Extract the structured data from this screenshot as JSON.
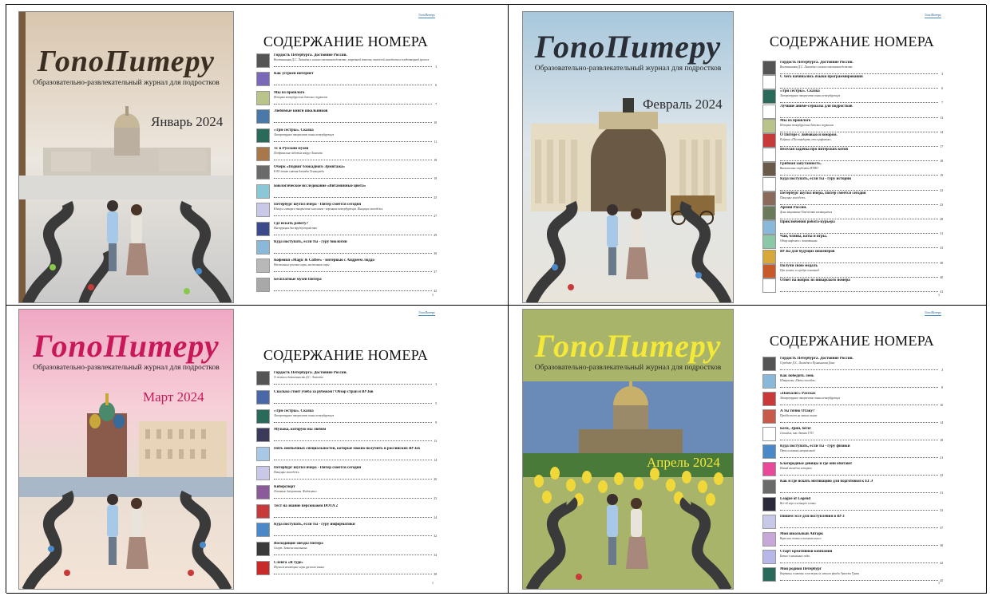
{
  "issues": [
    {
      "cover": {
        "title": "ГопоПитеру",
        "subtitle": "Образовательно-развлекательный журнал для подростков",
        "month": "Январь 2024",
        "colors": {
          "bg_top": "#d9c6ae",
          "bg_bottom": "#c9c9c9",
          "title": "#3a2e22",
          "month": "#2a2a2a",
          "frame": "#7a5a3c"
        }
      },
      "toc": {
        "brand": "ГопоПитеру",
        "heading": "СОДЕРЖАНИЕ НОМЕРА",
        "page_number": "1",
        "entries": [
          {
            "title": "Гордость Петербурга. Достояние России.",
            "sub": "Воспоминания Д.С. Лихачёва о самом счастливом детстве, запретной повести, тяжёлой молодости и плодотворной зрелости",
            "page": "3",
            "thumb": "#555555"
          },
          {
            "title": "Как устроен интернет",
            "sub": "",
            "page": "6",
            "thumb": "#7a68b8"
          },
          {
            "title": "Мы из прошлого",
            "sub": "История петербургских детских журналов",
            "page": "7",
            "thumb": "#b9c48a"
          },
          {
            "title": "Любимые книги школьников",
            "sub": "",
            "page": "10",
            "thumb": "#4a78a8"
          },
          {
            "title": "«Три сестры». Сказка",
            "sub": "Литературное творчество юных петербуржцев",
            "page": "11",
            "thumb": "#2a6a5a"
          },
          {
            "title": "Тс в Русский музей",
            "sub": "Поздравление задетых вокруг Лихачёва",
            "page": "18",
            "thumb": "#a8784a"
          },
          {
            "title": "Очерк «Подвиг блокадного Эрмитажа»",
            "sub": "К 80-летию снятия блокады Ленинграда",
            "page": "19",
            "thumb": "#6a6a6a"
          },
          {
            "title": "Биологическое исследование «Витаминные цвета»",
            "sub": "",
            "page": "25",
            "thumb": "#8ac8d8"
          },
          {
            "title": "Петербург шутил вчера - Питер смеётся сегодня",
            "sub": "Юмор и сатира в творчестве классиков - коренных петербуржцев. Пишущие молодёжь",
            "page": "27",
            "thumb": "#c8c8e8"
          },
          {
            "title": "Где искать работу?",
            "sub": "Инструкция для трудоустройства",
            "page": "29",
            "thumb": "#3a4a8a"
          },
          {
            "title": "Куда поступать, если ты - гуру биологии",
            "sub": "",
            "page": "30",
            "thumb": "#8ab8d8"
          },
          {
            "title": "Кофейня «Magic & Coffee» - интервью с Андреем Лоддо",
            "sub": "Настольные ролевые игры, настольные игры",
            "page": "37",
            "thumb": "#b8b8b8"
          },
          {
            "title": "Бесплатные музеи Питера",
            "sub": "",
            "page": "42",
            "thumb": "#a8a8a8"
          }
        ]
      }
    },
    {
      "cover": {
        "title": "ГопоПитеру",
        "subtitle": "Образовательно-развлекательный журнал для подростков",
        "month": "Февраль 2024",
        "colors": {
          "bg_top": "#a8c8dc",
          "bg_bottom": "#e8e4da",
          "title": "#2a2e36",
          "month": "#2a2a2a",
          "frame": "#999999"
        }
      },
      "toc": {
        "brand": "ГопоПитеру",
        "heading": "СОДЕРЖАНИЕ НОМЕРА",
        "page_number": "1",
        "entries": [
          {
            "title": "Гордость Петербурга. Достояние России.",
            "sub": "Воспоминания Д.С. Лихачёва о самом счастливом детстве",
            "page": "3",
            "thumb": "#555555"
          },
          {
            "title": "С чего начинались языки программирования",
            "sub": "",
            "page": "6",
            "thumb": "#ffffff"
          },
          {
            "title": "«Три сестры». Сказка",
            "sub": "Литературное творчество юных петербуржцев",
            "page": "7",
            "thumb": "#2a6a5a"
          },
          {
            "title": "Лучшие аниме-сериалы для подростков",
            "sub": "",
            "page": "13",
            "thumb": "#ffffff"
          },
          {
            "title": "Мы из прошлого",
            "sub": "История петербургских детских журналов",
            "page": "14",
            "thumb": "#b9c48a"
          },
          {
            "title": "О Питере с любовью и юмором.",
            "sub": "Рубрика «Шестнадцать лет в рифмовке»",
            "page": "17",
            "thumb": "#c83a3a"
          },
          {
            "title": "Весёлая задачка про питерских котов",
            "sub": "",
            "page": "18",
            "thumb": "#ffffff"
          },
          {
            "title": "Грибная запутанность.",
            "sub": "Внеклассные студенты ИТМО",
            "page": "19",
            "thumb": "#6a5a4a"
          },
          {
            "title": "Куда поступать, если ты - гуру истории",
            "sub": "",
            "page": "22",
            "thumb": "#ffffff"
          },
          {
            "title": "Петербург шутил вчера, Питер смеётся сегодня",
            "sub": "Пишущие молодёжь",
            "page": "23",
            "thumb": "#8a6a5a"
          },
          {
            "title": "Армия России.",
            "sub": "День защитника Отечества посвящается",
            "page": "28",
            "thumb": "#6a7a5a"
          },
          {
            "title": "Приключения робота-курьера",
            "sub": "",
            "page": "31",
            "thumb": "#8ab8d8"
          },
          {
            "title": "Чай, блины, коты и игры.",
            "sub": "Обзор кафешек с животными",
            "page": "33",
            "thumb": "#8ac8a8"
          },
          {
            "title": "ВУЗы для будущих инженеров",
            "sub": "",
            "page": "38",
            "thumb": "#d8a83a"
          },
          {
            "title": "Получи свою медаль",
            "sub": "Про золото и серебро олимпиад",
            "page": "40",
            "thumb": "#c85a2a"
          },
          {
            "title": "Ответ на вопрос из январского номера",
            "sub": "",
            "page": "41",
            "thumb": "#ffffff"
          }
        ]
      }
    },
    {
      "cover": {
        "title": "ГопоПитеру",
        "subtitle": "Образовательно-развлекательный журнал для подростков",
        "month": "Март 2024",
        "colors": {
          "bg_top": "#f0a8c4",
          "bg_bottom": "#f4e4d8",
          "title": "#c8185a",
          "month": "#c8185a",
          "frame": "#c87898"
        }
      },
      "toc": {
        "brand": "ГопоПитеру",
        "heading": "СОДЕРЖАНИЕ НОМЕРА",
        "page_number": "1",
        "entries": [
          {
            "title": "Гордость Петербурга. Достояние России.",
            "sub": "О жизни и деятельности Д.С. Лихачёва",
            "page": "3",
            "thumb": "#555555"
          },
          {
            "title": "Сколько стоит учёба за рубежом? Обзор стран и ВУЗов",
            "sub": "",
            "page": "5",
            "thumb": "#4a68a8"
          },
          {
            "title": "«Три сестры». Сказка",
            "sub": "Литературное творчество юных петербуржцев",
            "page": "9",
            "thumb": "#2a6a5a"
          },
          {
            "title": "Музыка, которую мы любим",
            "sub": "",
            "page": "13",
            "thumb": "#3a3a5a"
          },
          {
            "title": "Пять необычных специальностей, которые можно получить в российских ВУЗах",
            "sub": "",
            "page": "14",
            "thumb": "#a8c8e8"
          },
          {
            "title": "Петербург шутил вчера - Питер смеётся сегодня",
            "sub": "Пишущие молодёжь",
            "page": "20",
            "thumb": "#c8c8e8"
          },
          {
            "title": "Киберспорт",
            "sub": "Основные дисциплины. Фиджитал",
            "page": "23",
            "thumb": "#8a5a9a"
          },
          {
            "title": "Тест на знание персонажей DOTA 2",
            "sub": "",
            "page": "24",
            "thumb": "#c83a3a"
          },
          {
            "title": "Куда поступать, если ты - гуру информатики",
            "sub": "",
            "page": "32",
            "thumb": "#4a88c8"
          },
          {
            "title": "Восходящие звёзды Питера",
            "sub": "Спорт. Записки школьника.",
            "page": "34",
            "thumb": "#3a3a3a"
          },
          {
            "title": "Сленга «Я туде»",
            "sub": "Изучаем некоторые игры русского языка",
            "page": "38",
            "thumb": "#c82a2a"
          }
        ]
      }
    },
    {
      "cover": {
        "title": "ГопоПитеру",
        "subtitle": "Образовательно-развлекательный журнал для подростков",
        "month": "Апрель 2024",
        "colors": {
          "bg_top": "#a8b46a",
          "bg_bottom": "#9aaa5a",
          "title": "#f4e838",
          "month": "#f4e838",
          "frame": "#6a7a3a"
        }
      },
      "toc": {
        "brand": "ГопоПитеру",
        "heading": "СОДЕРЖАНИЕ НОМЕРА",
        "page_number": "1",
        "entries": [
          {
            "title": "Гордость Петербурга. Достояние России.",
            "sub": "О работе Д.С. Лихачёва в Пушкинском Доме",
            "page": "3",
            "thumb": "#555555"
          },
          {
            "title": "Как победить лень",
            "sub": "Шпаргалка «Пять способов»",
            "page": "8",
            "thumb": "#8ab8d8"
          },
          {
            "title": "«Поехали!» Рассказ",
            "sub": "Литературное творчество юных петербуржцев",
            "page": "10",
            "thumb": "#c83a3a"
          },
          {
            "title": "А ты точно Отаку?",
            "sub": "Пройди тест на знание аниме",
            "page": "14",
            "thumb": "#c85a4a"
          },
          {
            "title": "Беги, Эрни, беги!",
            "sub": "Спасайся, как сдавали ГТО",
            "page": "18",
            "thumb": "#ffffff"
          },
          {
            "title": "Куда поступать, если ты - гуру физики",
            "sub": "Пять основных направлений",
            "page": "21",
            "thumb": "#4a88c8"
          },
          {
            "title": "Благородные девицы и где они обитают",
            "sub": "Новый взгляд на историю",
            "page": "22",
            "thumb": "#e84a9a"
          },
          {
            "title": "Как и где искать мотивацию для подготовки к ЕГЭ",
            "sub": "",
            "page": "31",
            "thumb": "#6a6a6a"
          },
          {
            "title": "League of Legend",
            "sub": "Всё об игре в четырёх словах",
            "page": "33",
            "thumb": "#2a2a3a"
          },
          {
            "title": "Пишем эссе для поступления в ВУЗ",
            "sub": "",
            "page": "37",
            "thumb": "#c8c8e8"
          },
          {
            "title": "Мой школьный Автарк",
            "sub": "Взрослая жизнь в восьмом классе",
            "page": "38",
            "thumb": "#c8a8d8"
          },
          {
            "title": "Старт креативной компании",
            "sub": "Бизнес в школьные годы",
            "page": "42",
            "thumb": "#b8b8e8"
          },
          {
            "title": "Мой родной Петербург",
            "sub": "Картины, плакаты и постеры из личного фонда Эрнеста Грина",
            "page": "45",
            "thumb": "#2a6a5a"
          }
        ]
      }
    }
  ]
}
